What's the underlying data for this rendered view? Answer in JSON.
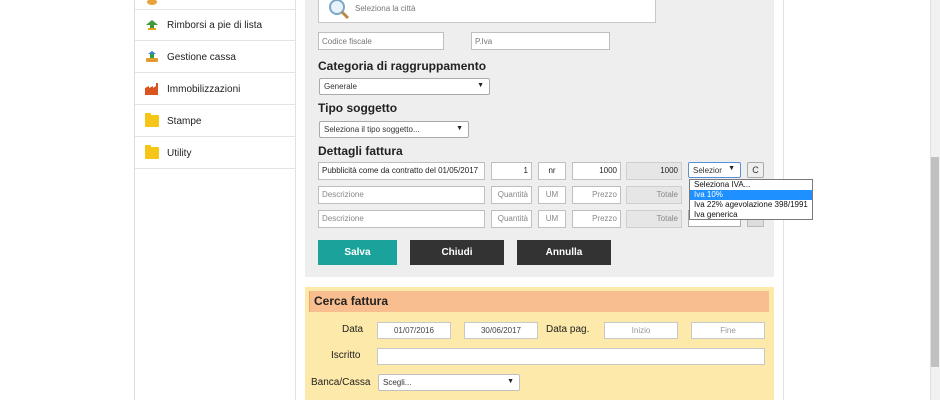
{
  "sidebar": {
    "items": [
      {
        "label": "Rimborsi a pie di lista",
        "icon": "refund-icon"
      },
      {
        "label": "Gestione cassa",
        "icon": "cash-icon"
      },
      {
        "label": "Immobilizzazioni",
        "icon": "factory-icon"
      },
      {
        "label": "Stampe",
        "icon": "folder-icon"
      },
      {
        "label": "Utility",
        "icon": "folder-icon"
      }
    ]
  },
  "form": {
    "city_placeholder": "Seleziona la città",
    "codice_fiscale_placeholder": "Codice fiscale",
    "piva_placeholder": "P.Iva",
    "categoria_heading": "Categoria di raggruppamento",
    "categoria_value": "Generale",
    "tipo_heading": "Tipo soggetto",
    "tipo_value": "Seleziona il tipo soggetto...",
    "dettagli_heading": "Dettagli fattura",
    "rows": [
      {
        "descrizione": "Pubblicità come da contratto del 01/05/2017",
        "quantita": "1",
        "um": "nr",
        "prezzo": "1000",
        "totale": "1000",
        "iva": "Selezior"
      },
      {
        "descrizione": "Descrizione",
        "quantita": "Quantità",
        "um": "UM",
        "prezzo": "Prezzo",
        "totale": "Totale",
        "iva": ""
      },
      {
        "descrizione": "Descrizione",
        "quantita": "Quantità",
        "um": "UM",
        "prezzo": "Prezzo",
        "totale": "Totale",
        "iva": ""
      }
    ],
    "c_button": "C",
    "iva_options": [
      "Seleziona IVA...",
      "Iva 10%",
      "Iva 22% agevolazione 398/1991",
      "Iva generica"
    ],
    "iva_highlighted_index": 1,
    "salva": "Salva",
    "chiudi": "Chiudi",
    "annulla": "Annulla"
  },
  "search": {
    "title": "Cerca fattura",
    "data_label": "Data",
    "data_from": "01/07/2016",
    "data_to": "30/06/2017",
    "data_pag_label": "Data pag.",
    "inizio_placeholder": "Inizio",
    "fine_placeholder": "Fine",
    "iscritto_label": "Iscritto",
    "iscritto_value": "",
    "banca_label": "Banca/Cassa",
    "banca_value": "Scegli..."
  },
  "colors": {
    "salva": "#1aa39a",
    "dark": "#333333",
    "panel": "#eeeeee",
    "search_bg": "#fde9a9",
    "search_head": "#f9be8f",
    "highlight": "#1e90ff"
  }
}
